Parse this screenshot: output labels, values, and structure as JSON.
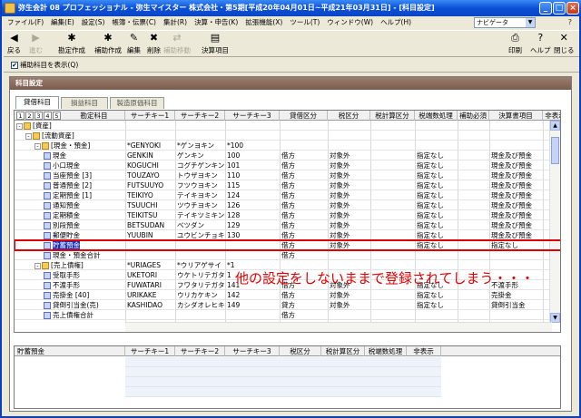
{
  "window": {
    "title": "弥生会計 08 プロフェッショナル - 弥生マイスター 株式会社・第5期[平成20年04月01日~平成21年03月31日] - [科目設定]",
    "controls": [
      "_",
      "□",
      "×"
    ]
  },
  "menu": {
    "items": [
      "ファイル(F)",
      "編集(E)",
      "設定(S)",
      "帳簿・伝票(C)",
      "集計(R)",
      "決算・申告(K)",
      "拡張機能(X)",
      "ツール(T)",
      "ウィンドウ(W)",
      "ヘルプ(H)"
    ],
    "navi_label": "ナビゲータ",
    "help_mark": "?"
  },
  "toolbar": {
    "left": [
      {
        "label": "戻る",
        "icon": "back-arrow-icon",
        "glyph": "◀",
        "disabled": false
      },
      {
        "label": "進む",
        "icon": "forward-arrow-icon",
        "glyph": "▶",
        "disabled": true
      },
      {
        "label": "勘定作成",
        "icon": "create-account-icon",
        "glyph": "✱",
        "disabled": false
      },
      {
        "label": "補助作成",
        "icon": "create-sub-account-icon",
        "glyph": "✱",
        "disabled": false
      },
      {
        "label": "編集",
        "icon": "edit-icon",
        "glyph": "✎",
        "disabled": false
      },
      {
        "label": "削除",
        "icon": "delete-icon",
        "glyph": "✖",
        "disabled": false
      },
      {
        "label": "補助移動",
        "icon": "move-sub-icon",
        "glyph": "⇄",
        "disabled": true
      },
      {
        "label": "決算項目",
        "icon": "settlement-item-icon",
        "glyph": "▤",
        "disabled": false
      }
    ],
    "right": [
      {
        "label": "印刷",
        "icon": "print-icon",
        "glyph": "⎙"
      },
      {
        "label": "ヘルプ",
        "icon": "help-icon",
        "glyph": "?"
      },
      {
        "label": "閉じる",
        "icon": "close-doc-icon",
        "glyph": "✕"
      }
    ]
  },
  "options": {
    "show_sub_accounts_label": "補助科目を表示(Q)",
    "show_sub_accounts_checked": true
  },
  "panel": {
    "title": "科目設定",
    "tabs": [
      "貸借科目",
      "損益科目",
      "製造原価科目"
    ],
    "active_tab": 0
  },
  "grid": {
    "levels": [
      "1",
      "2",
      "3",
      "4",
      "5"
    ],
    "columns": [
      "勘定科目",
      "サーチキー1",
      "サーチキー2",
      "サーチキー3",
      "貸借区分",
      "税区分",
      "税計算区分",
      "税端数処理",
      "補助必須",
      "決算書項目",
      "非表示"
    ],
    "rows": [
      {
        "name": "[資産]",
        "k1": "",
        "k2": "",
        "k3": "",
        "taishaku": "",
        "zei": "",
        "zeikeisan": "",
        "hasu": "",
        "hojo": "",
        "kessan": "",
        "hihyoji": "",
        "indent": 1,
        "icon": "folder",
        "expander": "-"
      },
      {
        "name": "[流動資産]",
        "k1": "",
        "k2": "",
        "k3": "",
        "taishaku": "",
        "zei": "",
        "zeikeisan": "",
        "hasu": "",
        "hojo": "",
        "kessan": "",
        "hihyoji": "",
        "indent": 2,
        "icon": "folder",
        "expander": "-"
      },
      {
        "name": "[現金・預金]",
        "k1": "*GENYOKI",
        "k2": "*ゲンヨキン",
        "k3": "*100",
        "taishaku": "",
        "zei": "",
        "zeikeisan": "",
        "hasu": "",
        "hojo": "",
        "kessan": "",
        "hihyoji": "",
        "indent": 3,
        "icon": "folder",
        "expander": "-"
      },
      {
        "name": "現金",
        "k1": "GENKIN",
        "k2": "ゲンキン",
        "k3": "100",
        "taishaku": "借方",
        "zei": "対象外",
        "zeikeisan": "",
        "hasu": "指定なし",
        "hojo": "",
        "kessan": "現金及び預金",
        "hihyoji": "",
        "indent": 4,
        "icon": "book",
        "expander": ""
      },
      {
        "name": "小口現金",
        "k1": "KOGUCHI",
        "k2": "コグチゲンキン",
        "k3": "101",
        "taishaku": "借方",
        "zei": "対象外",
        "zeikeisan": "",
        "hasu": "指定なし",
        "hojo": "",
        "kessan": "現金及び預金",
        "hihyoji": "",
        "indent": 4,
        "icon": "book",
        "expander": ""
      },
      {
        "name": "当座預金 [3]",
        "k1": "TOUZAYO",
        "k2": "トウザヨキン",
        "k3": "110",
        "taishaku": "借方",
        "zei": "対象外",
        "zeikeisan": "",
        "hasu": "指定なし",
        "hojo": "",
        "kessan": "現金及び預金",
        "hihyoji": "",
        "indent": 4,
        "icon": "book",
        "expander": ""
      },
      {
        "name": "普通預金 [2]",
        "k1": "FUTSUUYO",
        "k2": "フツウヨキン",
        "k3": "115",
        "taishaku": "借方",
        "zei": "対象外",
        "zeikeisan": "",
        "hasu": "指定なし",
        "hojo": "",
        "kessan": "現金及び預金",
        "hihyoji": "",
        "indent": 4,
        "icon": "book",
        "expander": ""
      },
      {
        "name": "定期預金 [1]",
        "k1": "TEIKIYO",
        "k2": "テイキヨキン",
        "k3": "124",
        "taishaku": "借方",
        "zei": "対象外",
        "zeikeisan": "",
        "hasu": "指定なし",
        "hojo": "",
        "kessan": "現金及び預金",
        "hihyoji": "",
        "indent": 4,
        "icon": "book",
        "expander": ""
      },
      {
        "name": "通知預金",
        "k1": "TSUUCHI",
        "k2": "ツウチヨキン",
        "k3": "126",
        "taishaku": "借方",
        "zei": "対象外",
        "zeikeisan": "",
        "hasu": "指定なし",
        "hojo": "",
        "kessan": "現金及び預金",
        "hihyoji": "",
        "indent": 4,
        "icon": "book",
        "expander": ""
      },
      {
        "name": "定期積金",
        "k1": "TEIKITSU",
        "k2": "テイキツミキン",
        "k3": "128",
        "taishaku": "借方",
        "zei": "対象外",
        "zeikeisan": "",
        "hasu": "指定なし",
        "hojo": "",
        "kessan": "現金及び預金",
        "hihyoji": "",
        "indent": 4,
        "icon": "book",
        "expander": ""
      },
      {
        "name": "別段預金",
        "k1": "BETSUDAN",
        "k2": "ベツダン",
        "k3": "129",
        "taishaku": "借方",
        "zei": "対象外",
        "zeikeisan": "",
        "hasu": "指定なし",
        "hojo": "",
        "kessan": "現金及び預金",
        "hihyoji": "",
        "indent": 4,
        "icon": "book",
        "expander": ""
      },
      {
        "name": "郵便貯金",
        "k1": "YUUBIN",
        "k2": "ユウビンチョキン",
        "k3": "130",
        "taishaku": "借方",
        "zei": "対象外",
        "zeikeisan": "",
        "hasu": "指定なし",
        "hojo": "",
        "kessan": "現金及び預金",
        "hihyoji": "",
        "indent": 4,
        "icon": "book",
        "expander": ""
      },
      {
        "name": "貯蓄預金",
        "k1": "",
        "k2": "",
        "k3": "",
        "taishaku": "借方",
        "zei": "対象外",
        "zeikeisan": "",
        "hasu": "指定なし",
        "hojo": "",
        "kessan": "指定なし",
        "hihyoji": "",
        "indent": 4,
        "icon": "book",
        "expander": "",
        "selected": true
      },
      {
        "name": "現金・預金合計",
        "k1": "",
        "k2": "",
        "k3": "",
        "taishaku": "借方",
        "zei": "",
        "zeikeisan": "",
        "hasu": "",
        "hojo": "",
        "kessan": "",
        "hihyoji": "",
        "indent": 4,
        "icon": "book",
        "expander": ""
      },
      {
        "name": "[売上債権]",
        "k1": "*URIAGES",
        "k2": "*ウリアゲサイ",
        "k3": "*1",
        "taishaku": "",
        "zei": "",
        "zeikeisan": "",
        "hasu": "",
        "hojo": "",
        "kessan": "",
        "hihyoji": "",
        "indent": 3,
        "icon": "folder",
        "expander": "-"
      },
      {
        "name": "受取手形",
        "k1": "UKETORI",
        "k2": "ウケトリテガタ",
        "k3": "1",
        "taishaku": "",
        "zei": "",
        "zeikeisan": "",
        "hasu": "",
        "hojo": "",
        "kessan": "",
        "hihyoji": "",
        "indent": 4,
        "icon": "book",
        "expander": ""
      },
      {
        "name": "不渡手形",
        "k1": "FUWATARI",
        "k2": "フワタリテガタ",
        "k3": "141",
        "taishaku": "借方",
        "zei": "対象外",
        "zeikeisan": "",
        "hasu": "指定なし",
        "hojo": "",
        "kessan": "不渡手形",
        "hihyoji": "",
        "indent": 4,
        "icon": "book",
        "expander": ""
      },
      {
        "name": "売掛金 [40]",
        "k1": "URIKAKE",
        "k2": "ウリカケキン",
        "k3": "142",
        "taishaku": "借方",
        "zei": "対象外",
        "zeikeisan": "",
        "hasu": "指定なし",
        "hojo": "",
        "kessan": "売掛金",
        "hihyoji": "",
        "indent": 4,
        "icon": "book",
        "expander": ""
      },
      {
        "name": "貸倒引当金(売)",
        "k1": "KASHIDAO",
        "k2": "カシダオレヒキ",
        "k3": "149",
        "taishaku": "貸方",
        "zei": "対象外",
        "zeikeisan": "",
        "hasu": "指定なし",
        "hojo": "",
        "kessan": "貸倒引当金",
        "hihyoji": "",
        "indent": 4,
        "icon": "book",
        "expander": ""
      },
      {
        "name": "売上債権合計",
        "k1": "",
        "k2": "",
        "k3": "",
        "taishaku": "借方",
        "zei": "",
        "zeikeisan": "",
        "hasu": "",
        "hojo": "",
        "kessan": "",
        "hihyoji": "",
        "indent": 4,
        "icon": "book",
        "expander": ""
      }
    ]
  },
  "annotation": "他の設定をしないままで登録されてしまう・・・",
  "sub_grid": {
    "label": "貯蓄預金",
    "columns": [
      "サーチキー1",
      "サーチキー2",
      "サーチキー3",
      "税区分",
      "税計算区分",
      "税端数処理",
      "非表示"
    ]
  }
}
